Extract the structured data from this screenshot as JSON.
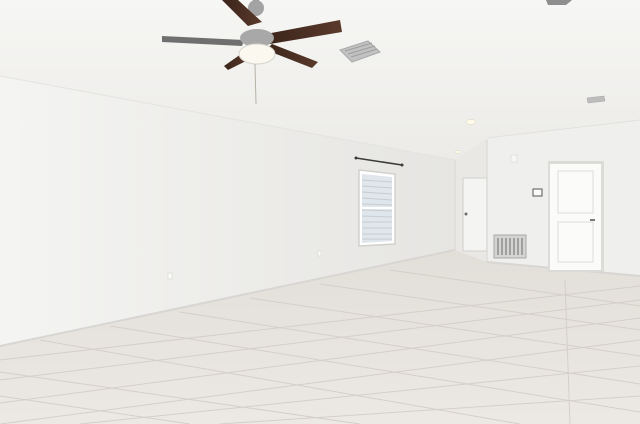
{
  "scene": {
    "kind": "photo",
    "subject": "empty-room-interior",
    "elements": [
      "ceiling-fan",
      "ceiling-vent",
      "window-with-blinds",
      "curtain-rod",
      "exterior-door",
      "interior-door",
      "floor-vent",
      "recessed-lights",
      "tile-floor"
    ]
  },
  "palette": {
    "ceiling": "#f4f4f2",
    "wall_left": "#f1f1ef",
    "wall_back": "#ededeb",
    "floor": "#e4e0db",
    "grout": "#d2cdc6",
    "fan_blade": "#4a2e22",
    "fan_metal": "#9a9a9a",
    "vent": "#b5b5b5",
    "window_glass": "#dfe6ec"
  }
}
